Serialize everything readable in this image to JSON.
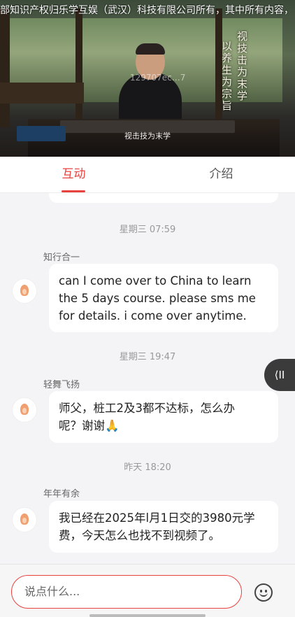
{
  "video": {
    "ticker": "部知识产权归乐学互娱（武汉）科技有限公司所有，其中所有内容，",
    "watermark": "129707ec…7",
    "subtitle": "视击技为末学",
    "calligraphy_right": "视技击为末学",
    "calligraphy_left": "以养生为宗旨"
  },
  "tabs": [
    {
      "label": "互动",
      "active": true
    },
    {
      "label": "介绍",
      "active": false
    }
  ],
  "messages": [
    {
      "timestamp": "星期三 07:59",
      "user": "知行合一",
      "text": "can I come over to China to learn\nthe 5 days course. please sms me\nfor details. i come over anytime."
    },
    {
      "timestamp": "星期三 19:47",
      "user": "轻舞飞扬",
      "text": "师父，桩工2及3都不达标，怎么办\n呢？谢谢🙏"
    },
    {
      "timestamp": "昨天 18:20",
      "user": "年年有余",
      "text": "我已经在2025年l月1日交的3980元学\n费，今天怎么也找不到视频了。"
    }
  ],
  "input": {
    "placeholder": "说点什么..."
  },
  "float_button": {
    "label": "⟨II"
  },
  "icons": {
    "emoji": "smiley-face-icon",
    "collapse": "collapse-panel-icon"
  },
  "colors": {
    "accent": "#e8423f"
  }
}
